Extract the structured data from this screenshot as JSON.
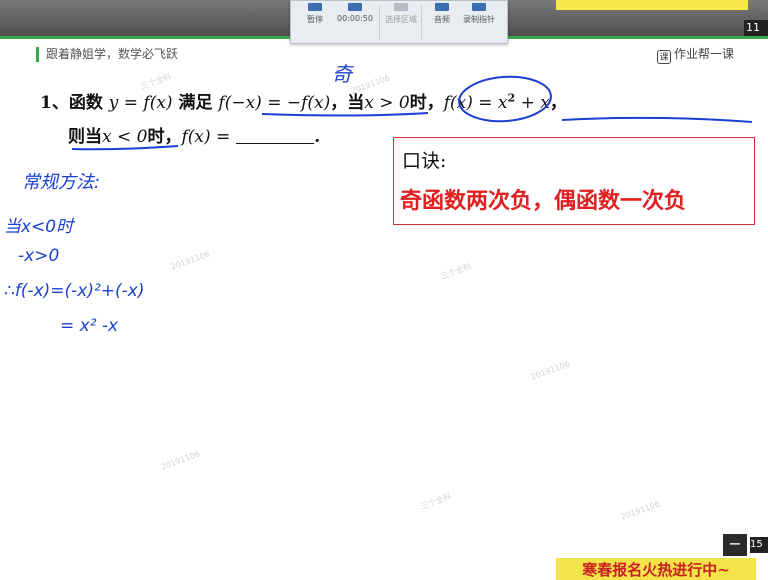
{
  "recorder_toolbar": {
    "pause_label": "暂停",
    "timer": "00:00:50",
    "select_area_label": "选择区域",
    "audio_label": "音频",
    "record_pointer_label": "录制指针"
  },
  "page_number_top": "11",
  "brand": {
    "slogan": "跟着静姐学，数学必飞跃",
    "logo_badge": "课",
    "logo_text": "作业帮一课"
  },
  "question": {
    "number": "1、",
    "line1_prefix": "函数",
    "line1_func": "y = f(x)",
    "line1_mid": "满足",
    "line1_cond": "f(−x) = −f(x)",
    "line1_when": "，当",
    "line1_ineq": "x > 0",
    "line1_shi": "时，",
    "line1_expr_a": "f(x) = x",
    "line1_exp": "2",
    "line1_expr_b": " + x",
    "line1_end": "，",
    "line2_prefix": "则当",
    "line2_ineq": "x < 0",
    "line2_shi": "时，",
    "line2_expr": "f(x) =",
    "line2_end": "."
  },
  "mnemonic": {
    "title": "口诀:",
    "body": "奇函数两次负，偶函数一次负"
  },
  "handwriting": {
    "odd_note": "奇",
    "method": "常规方法:",
    "step1": "当x<0时",
    "step2": "-x>0",
    "step3": "∴f(-x)=(-x)²+(-x)",
    "step4": "= x² -x"
  },
  "bottom_banner": "寒春报名火热进行中~",
  "minus_button": "−",
  "page_number_bottom": "15"
}
